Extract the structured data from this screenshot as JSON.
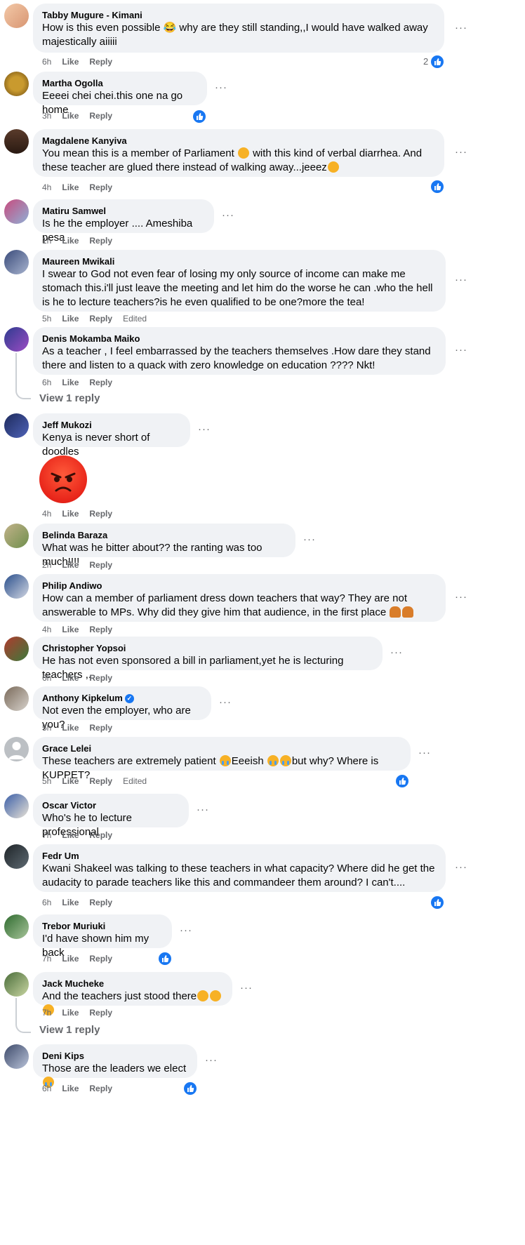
{
  "comments": {
    "c1": {
      "name": "Tabby Mugure - Kimani",
      "text": "How is this even possible 😂 why are they still standing,,I would have walked away majestically aiiiii",
      "time": "6h",
      "like": "Like",
      "reply": "Reply",
      "reactions": "2"
    },
    "c2": {
      "name": "Martha Ogolla",
      "text": "Eeeei chei chei.this one na go home",
      "time": "3h",
      "like": "Like",
      "reply": "Reply"
    },
    "c3": {
      "name": "Magdalene Kanyiva",
      "text_a": "You mean this is a member of Parliament",
      "text_b": "with this kind of verbal diarrhea. And these teacher are glued there instead of walking away...jeeez",
      "time": "4h",
      "like": "Like",
      "reply": "Reply"
    },
    "c4": {
      "name": "Matiru Samwel",
      "text": "Is he the employer .... Ameshiba pesa",
      "time": "1h",
      "like": "Like",
      "reply": "Reply"
    },
    "c5": {
      "name": "Maureen Mwikali",
      "text": "I swear to God not even fear of losing my only source of income can make me stomach this.i'll just leave the meeting and let him do the worse he can .who the hell is he to lecture teachers?is he even qualified to be one?more the tea!",
      "time": "5h",
      "like": "Like",
      "reply": "Reply",
      "edited": "Edited"
    },
    "c6": {
      "name": "Denis Mokamba Maiko",
      "text": "As a teacher , I feel embarrassed by the teachers themselves .How dare they stand there and listen to a quack with zero knowledge on education ???? Nkt!",
      "time": "6h",
      "like": "Like",
      "reply": "Reply",
      "view_replies": "View 1 reply"
    },
    "c7": {
      "name": "Jeff Mukozi",
      "text": "Kenya is never short of doodles",
      "time": "4h",
      "like": "Like",
      "reply": "Reply"
    },
    "c8": {
      "name": "Belinda Baraza",
      "text": "What was he bitter about?? the ranting was too much!!!!",
      "time": "2h",
      "like": "Like",
      "reply": "Reply"
    },
    "c9": {
      "name": "Philip Andiwo",
      "text": "How can a member of parliament dress down teachers that way? They are not answerable to MPs. Why did they give him that audience, in the first place",
      "time": "4h",
      "like": "Like",
      "reply": "Reply"
    },
    "c10": {
      "name": "Christopher Yopsoi",
      "text": "He has not even sponsored a bill in parliament,yet he is lecturing teachers ,.",
      "time": "6h",
      "like": "Like",
      "reply": "Reply"
    },
    "c11": {
      "name": "Anthony Kipkelum",
      "text": "Not even the employer, who are you?",
      "time": "5h",
      "like": "Like",
      "reply": "Reply"
    },
    "c12": {
      "name": "Grace Lelei",
      "text_a": "These teachers are extremely patient",
      "text_b": "Eeeish",
      "text_c": "but why? Where is KUPPET?",
      "time": "5h",
      "like": "Like",
      "reply": "Reply",
      "edited": "Edited"
    },
    "c13": {
      "name": "Oscar Victor",
      "text": "Who's he to lecture professional",
      "time": "7h",
      "like": "Like",
      "reply": "Reply"
    },
    "c14": {
      "name": "Fedr Um",
      "text": "Kwani Shakeel was talking to these teachers in what capacity? Where did he get the audacity to parade teachers like this and commandeer them around? I can't....",
      "time": "6h",
      "like": "Like",
      "reply": "Reply"
    },
    "c15": {
      "name": "Trebor Muriuki",
      "text": "I'd have shown him my back",
      "time": "7h",
      "like": "Like",
      "reply": "Reply"
    },
    "c16": {
      "name": "Jack Mucheke",
      "text": "And the teachers just stood there",
      "time": "7h",
      "like": "Like",
      "reply": "Reply",
      "view_replies": "View 1 reply"
    },
    "c17": {
      "name": "Deni Kips",
      "text": "Those are the leaders we elect",
      "time": "6h",
      "like": "Like",
      "reply": "Reply"
    }
  },
  "ui": {
    "more": "···"
  },
  "colors": {
    "like_blue": "#1877f2",
    "bubble": "#f0f2f5",
    "meta": "#65676b"
  }
}
